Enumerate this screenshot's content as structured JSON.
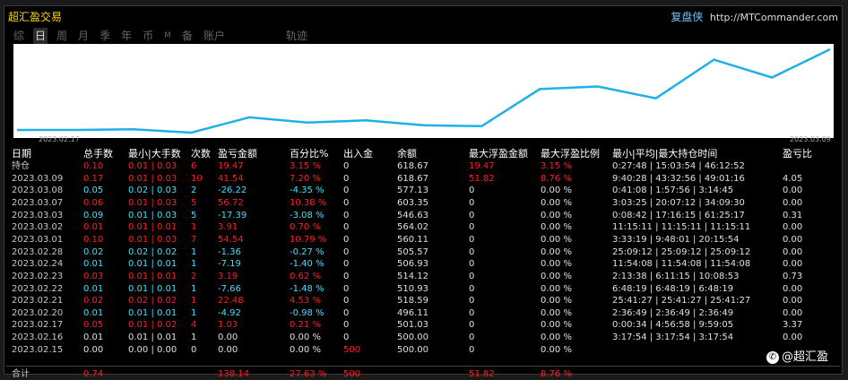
{
  "window": {
    "title": "超汇盈交易"
  },
  "brand": {
    "name": "复盘侠",
    "url": "http://MTCommander.com"
  },
  "tabs": [
    "综",
    "日",
    "周",
    "月",
    "季",
    "年",
    "币",
    "M",
    "备",
    "账户",
    "轨迹"
  ],
  "active_tab": "日",
  "chart_data": {
    "type": "line",
    "x": [
      "2023.02.15",
      "2023.02.16",
      "2023.02.17",
      "2023.02.20",
      "2023.02.21",
      "2023.02.22",
      "2023.02.23",
      "2023.02.24",
      "2023.02.28",
      "2023.03.01",
      "2023.03.02",
      "2023.03.03",
      "2023.03.07",
      "2023.03.08",
      "2023.03.09"
    ],
    "values": [
      500.0,
      500.0,
      501.03,
      496.11,
      518.59,
      510.93,
      514.12,
      506.93,
      505.57,
      560.11,
      564.02,
      546.63,
      603.35,
      577.13,
      618.67
    ],
    "x_tick_labels": [
      "2023.02.17",
      "2023.03.09"
    ],
    "line_color": "#1fb0e8",
    "grid": false
  },
  "table": {
    "headers": [
      "日期",
      "总手数",
      "最小|大手数",
      "次数",
      "盈亏金额",
      "百分比%",
      "出入金",
      "余额",
      "最大浮盈金额",
      "最大浮盈比例",
      "最小|平均|最大持仓时间",
      "盈亏比"
    ],
    "rows": [
      {
        "date": "持仓",
        "lots": "0.10",
        "minmax": "0.01 | 0.03",
        "count": "6",
        "pnl": "19.47",
        "pct": "3.15 %",
        "io": "0",
        "bal": "618.67",
        "mfe": "19.47",
        "mfep": "3.15 %",
        "time": "0:27:48 | 15:03:54 | 46:12:52",
        "ratio": "",
        "color": "red",
        "io_color": "white",
        "mfe_color": "red"
      },
      {
        "date": "2023.03.09",
        "lots": "0.17",
        "minmax": "0.01 | 0.03",
        "count": "10",
        "pnl": "41.54",
        "pct": "7.20 %",
        "io": "0",
        "bal": "618.67",
        "mfe": "51.82",
        "mfep": "8.76 %",
        "time": "9:40:28 | 43:32:56 | 49:01:16",
        "ratio": "4.05",
        "color": "red",
        "io_color": "white",
        "mfe_color": "red"
      },
      {
        "date": "2023.03.08",
        "lots": "0.05",
        "minmax": "0.02 | 0.03",
        "count": "2",
        "pnl": "-26.22",
        "pct": "-4.35 %",
        "io": "0",
        "bal": "577.13",
        "mfe": "0",
        "mfep": "0.00 %",
        "time": "0:41:08 | 1:57:56 | 3:14:45",
        "ratio": "0.00",
        "color": "cyan",
        "io_color": "white",
        "mfe_color": "white"
      },
      {
        "date": "2023.03.07",
        "lots": "0.06",
        "minmax": "0.01 | 0.03",
        "count": "5",
        "pnl": "56.72",
        "pct": "10.38 %",
        "io": "0",
        "bal": "603.35",
        "mfe": "0",
        "mfep": "0.00 %",
        "time": "3:03:25 | 20:07:12 | 34:09:30",
        "ratio": "0.00",
        "color": "red",
        "io_color": "white",
        "mfe_color": "white"
      },
      {
        "date": "2023.03.03",
        "lots": "0.09",
        "minmax": "0.01 | 0.03",
        "count": "5",
        "pnl": "-17.39",
        "pct": "-3.08 %",
        "io": "0",
        "bal": "546.63",
        "mfe": "0",
        "mfep": "0.00 %",
        "time": "0:08:42 | 17:16:15 | 61:25:17",
        "ratio": "0.31",
        "color": "cyan",
        "io_color": "white",
        "mfe_color": "white"
      },
      {
        "date": "2023.03.02",
        "lots": "0.01",
        "minmax": "0.01 | 0.01",
        "count": "1",
        "pnl": "3.91",
        "pct": "0.70 %",
        "io": "0",
        "bal": "564.02",
        "mfe": "0",
        "mfep": "0.00 %",
        "time": "11:15:11 | 11:15:11 | 11:15:11",
        "ratio": "0.00",
        "color": "red",
        "io_color": "white",
        "mfe_color": "white"
      },
      {
        "date": "2023.03.01",
        "lots": "0.10",
        "minmax": "0.01 | 0.03",
        "count": "7",
        "pnl": "54.54",
        "pct": "10.79 %",
        "io": "0",
        "bal": "560.11",
        "mfe": "0",
        "mfep": "0.00 %",
        "time": "3:33:19 | 9:48:01 | 20:15:54",
        "ratio": "0.00",
        "color": "red",
        "io_color": "white",
        "mfe_color": "white"
      },
      {
        "date": "2023.02.28",
        "lots": "0.02",
        "minmax": "0.02 | 0.02",
        "count": "1",
        "pnl": "-1.36",
        "pct": "-0.27 %",
        "io": "0",
        "bal": "505.57",
        "mfe": "0",
        "mfep": "0.00 %",
        "time": "25:09:12 | 25:09:12 | 25:09:12",
        "ratio": "0.00",
        "color": "cyan",
        "io_color": "white",
        "mfe_color": "white"
      },
      {
        "date": "2023.02.24",
        "lots": "0.01",
        "minmax": "0.01 | 0.01",
        "count": "1",
        "pnl": "-7.19",
        "pct": "-1.40 %",
        "io": "0",
        "bal": "506.93",
        "mfe": "0",
        "mfep": "0.00 %",
        "time": "11:54:08 | 11:54:08 | 11:54:08",
        "ratio": "0.00",
        "color": "cyan",
        "io_color": "white",
        "mfe_color": "white"
      },
      {
        "date": "2023.02.23",
        "lots": "0.03",
        "minmax": "0.01 | 0.01",
        "count": "2",
        "pnl": "3.19",
        "pct": "0.62 %",
        "io": "0",
        "bal": "514.12",
        "mfe": "0",
        "mfep": "0.00 %",
        "time": "2:13:38 | 6:11:15 | 10:08:53",
        "ratio": "0.73",
        "color": "red",
        "io_color": "white",
        "mfe_color": "white"
      },
      {
        "date": "2023.02.22",
        "lots": "0.01",
        "minmax": "0.01 | 0.01",
        "count": "1",
        "pnl": "-7.66",
        "pct": "-1.48 %",
        "io": "0",
        "bal": "510.93",
        "mfe": "0",
        "mfep": "0.00 %",
        "time": "6:48:19 | 6:48:19 | 6:48:19",
        "ratio": "0.00",
        "color": "cyan",
        "io_color": "white",
        "mfe_color": "white"
      },
      {
        "date": "2023.02.21",
        "lots": "0.02",
        "minmax": "0.02 | 0.02",
        "count": "1",
        "pnl": "22.48",
        "pct": "4.53 %",
        "io": "0",
        "bal": "518.59",
        "mfe": "0",
        "mfep": "0.00 %",
        "time": "25:41:27 | 25:41:27 | 25:41:27",
        "ratio": "0.00",
        "color": "red",
        "io_color": "white",
        "mfe_color": "white"
      },
      {
        "date": "2023.02.20",
        "lots": "0.01",
        "minmax": "0.01 | 0.01",
        "count": "1",
        "pnl": "-4.92",
        "pct": "-0.98 %",
        "io": "0",
        "bal": "496.11",
        "mfe": "0",
        "mfep": "0.00 %",
        "time": "2:36:49 | 2:36:49 | 2:36:49",
        "ratio": "0.00",
        "color": "cyan",
        "io_color": "white",
        "mfe_color": "white"
      },
      {
        "date": "2023.02.17",
        "lots": "0.05",
        "minmax": "0.01 | 0.02",
        "count": "4",
        "pnl": "1.03",
        "pct": "0.21 %",
        "io": "0",
        "bal": "501.03",
        "mfe": "0",
        "mfep": "0.00 %",
        "time": "0:00:34 | 4:56:58 | 9:59:05",
        "ratio": "3.37",
        "color": "red",
        "io_color": "white",
        "mfe_color": "white"
      },
      {
        "date": "2023.02.16",
        "lots": "0.01",
        "minmax": "0.01 | 0.01",
        "count": "1",
        "pnl": "0.00",
        "pct": "0.00 %",
        "io": "0",
        "bal": "500.00",
        "mfe": "0",
        "mfep": "0.00 %",
        "time": "3:17:54 | 3:17:54 | 3:17:54",
        "ratio": "0.00",
        "color": "white",
        "io_color": "white",
        "mfe_color": "white"
      },
      {
        "date": "2023.02.15",
        "lots": "0.00",
        "minmax": "0.00 | 0.00",
        "count": "0",
        "pnl": "0.00",
        "pct": "0.00 %",
        "io": "500",
        "bal": "500.00",
        "mfe": "0",
        "mfep": "0.00 %",
        "time": "",
        "ratio": "",
        "color": "white",
        "io_color": "red",
        "mfe_color": "white"
      }
    ],
    "total": {
      "date": "合计",
      "lots": "0.74",
      "pnl": "138.14",
      "pct": "27.63 %",
      "io": "500",
      "mfe": "51.82",
      "mfep": "8.76 %"
    }
  },
  "watermark": {
    "text": "@超汇盈"
  }
}
